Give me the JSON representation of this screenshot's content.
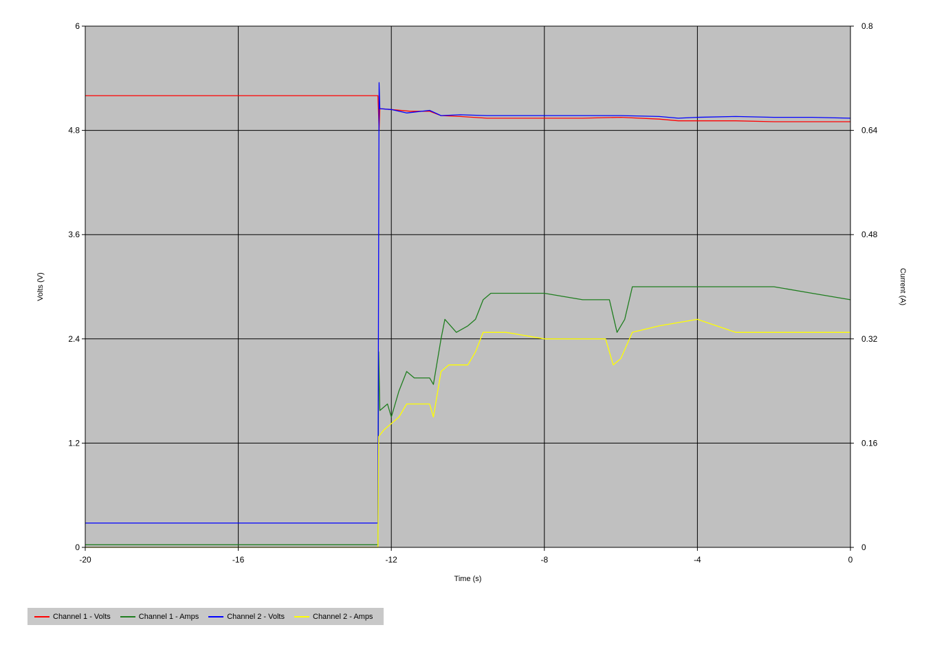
{
  "chart_data": {
    "type": "line",
    "xlabel": "Time (s)",
    "ylabel": "Volts (V)",
    "y2label": "Current (A)",
    "xlim": [
      -20,
      0
    ],
    "ylim": [
      0,
      6
    ],
    "y2lim": [
      0,
      0.8
    ],
    "xticks": [
      "-20",
      "-16",
      "-12",
      "-8",
      "-4",
      "0"
    ],
    "yticks": [
      "0",
      "1.2",
      "2.4",
      "3.6",
      "4.8",
      "6"
    ],
    "y2ticks": [
      "0",
      "0.16",
      "0.32",
      "0.48",
      "0.64",
      "0.8"
    ],
    "grid": true,
    "background": "#c0c0c0",
    "legend_position": "bottom-left",
    "series": [
      {
        "name": "Channel 1 - Volts",
        "color": "#ff0000",
        "axis": "left",
        "points": [
          [
            -20,
            5.2
          ],
          [
            -12.35,
            5.2
          ],
          [
            -12.32,
            4.8
          ],
          [
            -12.3,
            5.05
          ],
          [
            -12.0,
            5.04
          ],
          [
            -11.5,
            5.02
          ],
          [
            -11.0,
            5.02
          ],
          [
            -10.7,
            4.97
          ],
          [
            -10.2,
            4.96
          ],
          [
            -9.5,
            4.94
          ],
          [
            -9.0,
            4.94
          ],
          [
            -8.0,
            4.94
          ],
          [
            -7.0,
            4.94
          ],
          [
            -6.0,
            4.95
          ],
          [
            -5.0,
            4.93
          ],
          [
            -4.5,
            4.91
          ],
          [
            -4.0,
            4.91
          ],
          [
            -3.0,
            4.91
          ],
          [
            -2.0,
            4.9
          ],
          [
            -1.0,
            4.9
          ],
          [
            0,
            4.9
          ]
        ]
      },
      {
        "name": "Channel 1 - Amps",
        "color": "#1e7d1e",
        "axis": "right",
        "points": [
          [
            -20,
            0.004
          ],
          [
            -12.35,
            0.004
          ],
          [
            -12.33,
            0.3
          ],
          [
            -12.3,
            0.21
          ],
          [
            -12.1,
            0.22
          ],
          [
            -12.0,
            0.2
          ],
          [
            -11.8,
            0.24
          ],
          [
            -11.6,
            0.27
          ],
          [
            -11.4,
            0.26
          ],
          [
            -11.0,
            0.26
          ],
          [
            -10.9,
            0.25
          ],
          [
            -10.7,
            0.32
          ],
          [
            -10.6,
            0.35
          ],
          [
            -10.3,
            0.33
          ],
          [
            -10.0,
            0.34
          ],
          [
            -9.8,
            0.35
          ],
          [
            -9.6,
            0.38
          ],
          [
            -9.4,
            0.39
          ],
          [
            -9.0,
            0.39
          ],
          [
            -8.5,
            0.39
          ],
          [
            -8.0,
            0.39
          ],
          [
            -7.0,
            0.38
          ],
          [
            -6.3,
            0.38
          ],
          [
            -6.1,
            0.33
          ],
          [
            -5.9,
            0.35
          ],
          [
            -5.7,
            0.4
          ],
          [
            -5.0,
            0.4
          ],
          [
            -4.0,
            0.4
          ],
          [
            -3.0,
            0.4
          ],
          [
            -2.0,
            0.4
          ],
          [
            -1.0,
            0.39
          ],
          [
            0,
            0.38
          ]
        ]
      },
      {
        "name": "Channel 2 - Volts",
        "color": "#0000ff",
        "axis": "left",
        "points": [
          [
            -20,
            0.28
          ],
          [
            -12.35,
            0.28
          ],
          [
            -12.32,
            5.35
          ],
          [
            -12.3,
            5.05
          ],
          [
            -12.0,
            5.04
          ],
          [
            -11.6,
            5.0
          ],
          [
            -11.0,
            5.03
          ],
          [
            -10.7,
            4.97
          ],
          [
            -10.2,
            4.98
          ],
          [
            -9.5,
            4.97
          ],
          [
            -9.0,
            4.97
          ],
          [
            -8.0,
            4.97
          ],
          [
            -7.0,
            4.97
          ],
          [
            -6.0,
            4.97
          ],
          [
            -5.0,
            4.96
          ],
          [
            -4.5,
            4.94
          ],
          [
            -4.0,
            4.95
          ],
          [
            -3.0,
            4.96
          ],
          [
            -2.0,
            4.95
          ],
          [
            -1.0,
            4.95
          ],
          [
            0,
            4.94
          ]
        ]
      },
      {
        "name": "Channel 2 - Amps",
        "color": "#ffff00",
        "axis": "right",
        "points": [
          [
            -20,
            0.0
          ],
          [
            -12.35,
            0.0
          ],
          [
            -12.33,
            0.17
          ],
          [
            -12.2,
            0.18
          ],
          [
            -12.0,
            0.19
          ],
          [
            -11.8,
            0.2
          ],
          [
            -11.6,
            0.22
          ],
          [
            -11.0,
            0.22
          ],
          [
            -10.9,
            0.2
          ],
          [
            -10.7,
            0.27
          ],
          [
            -10.5,
            0.28
          ],
          [
            -10.0,
            0.28
          ],
          [
            -9.8,
            0.3
          ],
          [
            -9.6,
            0.33
          ],
          [
            -9.0,
            0.33
          ],
          [
            -8.0,
            0.32
          ],
          [
            -7.0,
            0.32
          ],
          [
            -6.4,
            0.32
          ],
          [
            -6.2,
            0.28
          ],
          [
            -6.0,
            0.29
          ],
          [
            -5.7,
            0.33
          ],
          [
            -5.0,
            0.34
          ],
          [
            -4.0,
            0.35
          ],
          [
            -3.0,
            0.33
          ],
          [
            -2.0,
            0.33
          ],
          [
            -1.0,
            0.33
          ],
          [
            0,
            0.33
          ]
        ]
      }
    ]
  }
}
